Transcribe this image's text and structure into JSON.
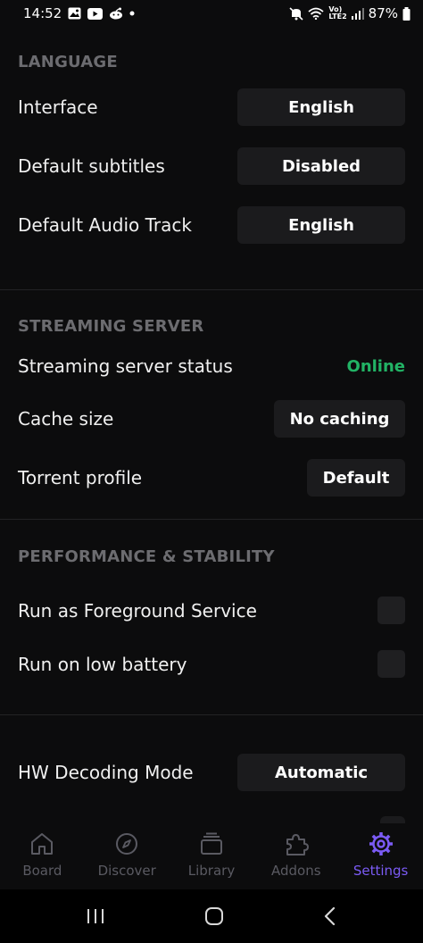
{
  "status_bar": {
    "time": "14:52",
    "battery": "87%",
    "network": "LTE2",
    "volte": "Vo)"
  },
  "sections": {
    "language": {
      "title": "LANGUAGE",
      "interface": {
        "label": "Interface",
        "value": "English"
      },
      "subtitles": {
        "label": "Default subtitles",
        "value": "Disabled"
      },
      "audio": {
        "label": "Default Audio Track",
        "value": "English"
      }
    },
    "streaming": {
      "title": "STREAMING SERVER",
      "status": {
        "label": "Streaming server status",
        "value": "Online"
      },
      "cache": {
        "label": "Cache size",
        "value": "No caching"
      },
      "torrent": {
        "label": "Torrent profile",
        "value": "Default"
      }
    },
    "performance": {
      "title": "PERFORMANCE & STABILITY",
      "foreground": {
        "label": "Run as Foreground Service",
        "checked": false
      },
      "low_battery": {
        "label": "Run on low battery",
        "checked": false
      }
    },
    "decoding": {
      "hw": {
        "label": "HW Decoding Mode",
        "value": "Automatic"
      }
    }
  },
  "bottom_nav": {
    "board": "Board",
    "discover": "Discover",
    "library": "Library",
    "addons": "Addons",
    "settings": "Settings"
  },
  "colors": {
    "accent": "#7b5bf5",
    "online": "#22b365",
    "background": "#0c0c0d"
  }
}
